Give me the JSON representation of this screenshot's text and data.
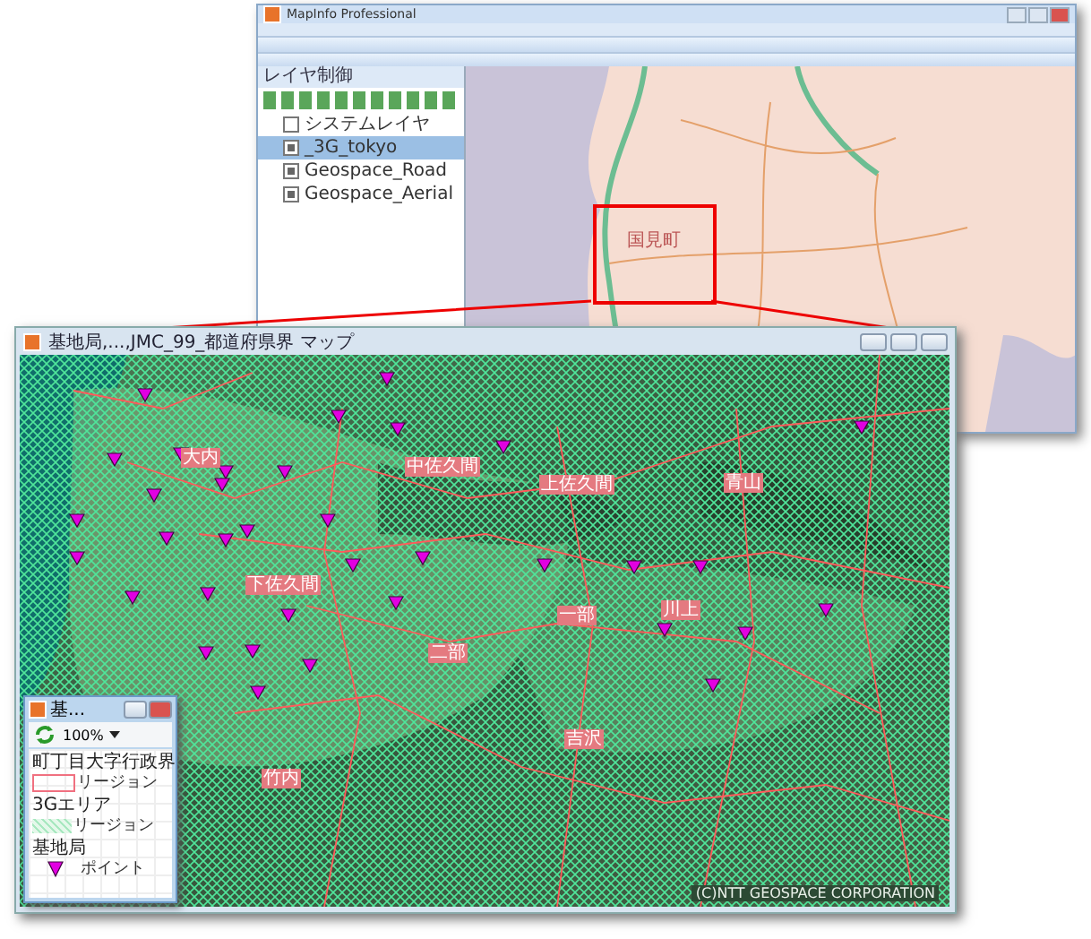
{
  "main_window": {
    "title": "MapInfo Professional",
    "layer_panel": {
      "title": "レイヤ制御",
      "layers": [
        {
          "name": "システムレイヤ",
          "visible": false,
          "selected": false
        },
        {
          "name": "_3G_tokyo",
          "visible": true,
          "selected": true
        },
        {
          "name": "Geospace_Road",
          "visible": true,
          "selected": false
        },
        {
          "name": "Geospace_Aerial",
          "visible": true,
          "selected": false
        }
      ]
    },
    "map_label": "国見町"
  },
  "map_window": {
    "title": "基地局,...,JMC_99_都道府県界 マップ",
    "place_labels": [
      "大内",
      "中佐久間",
      "上佐久間",
      "青山",
      "下佐久間",
      "二部",
      "一部",
      "川上",
      "吉沢",
      "竹内"
    ],
    "copyright": "(C)NTT GEOSPACE CORPORATION"
  },
  "legend": {
    "title": "基...",
    "zoom": "100%",
    "sections": [
      {
        "heading": "町丁目大字行政界",
        "kind": "region-outline",
        "label": "リージョン"
      },
      {
        "heading": "3Gエリア",
        "kind": "region-hatch",
        "label": "リージョン"
      },
      {
        "heading": "基地局",
        "kind": "point",
        "label": "ポイント"
      }
    ]
  }
}
